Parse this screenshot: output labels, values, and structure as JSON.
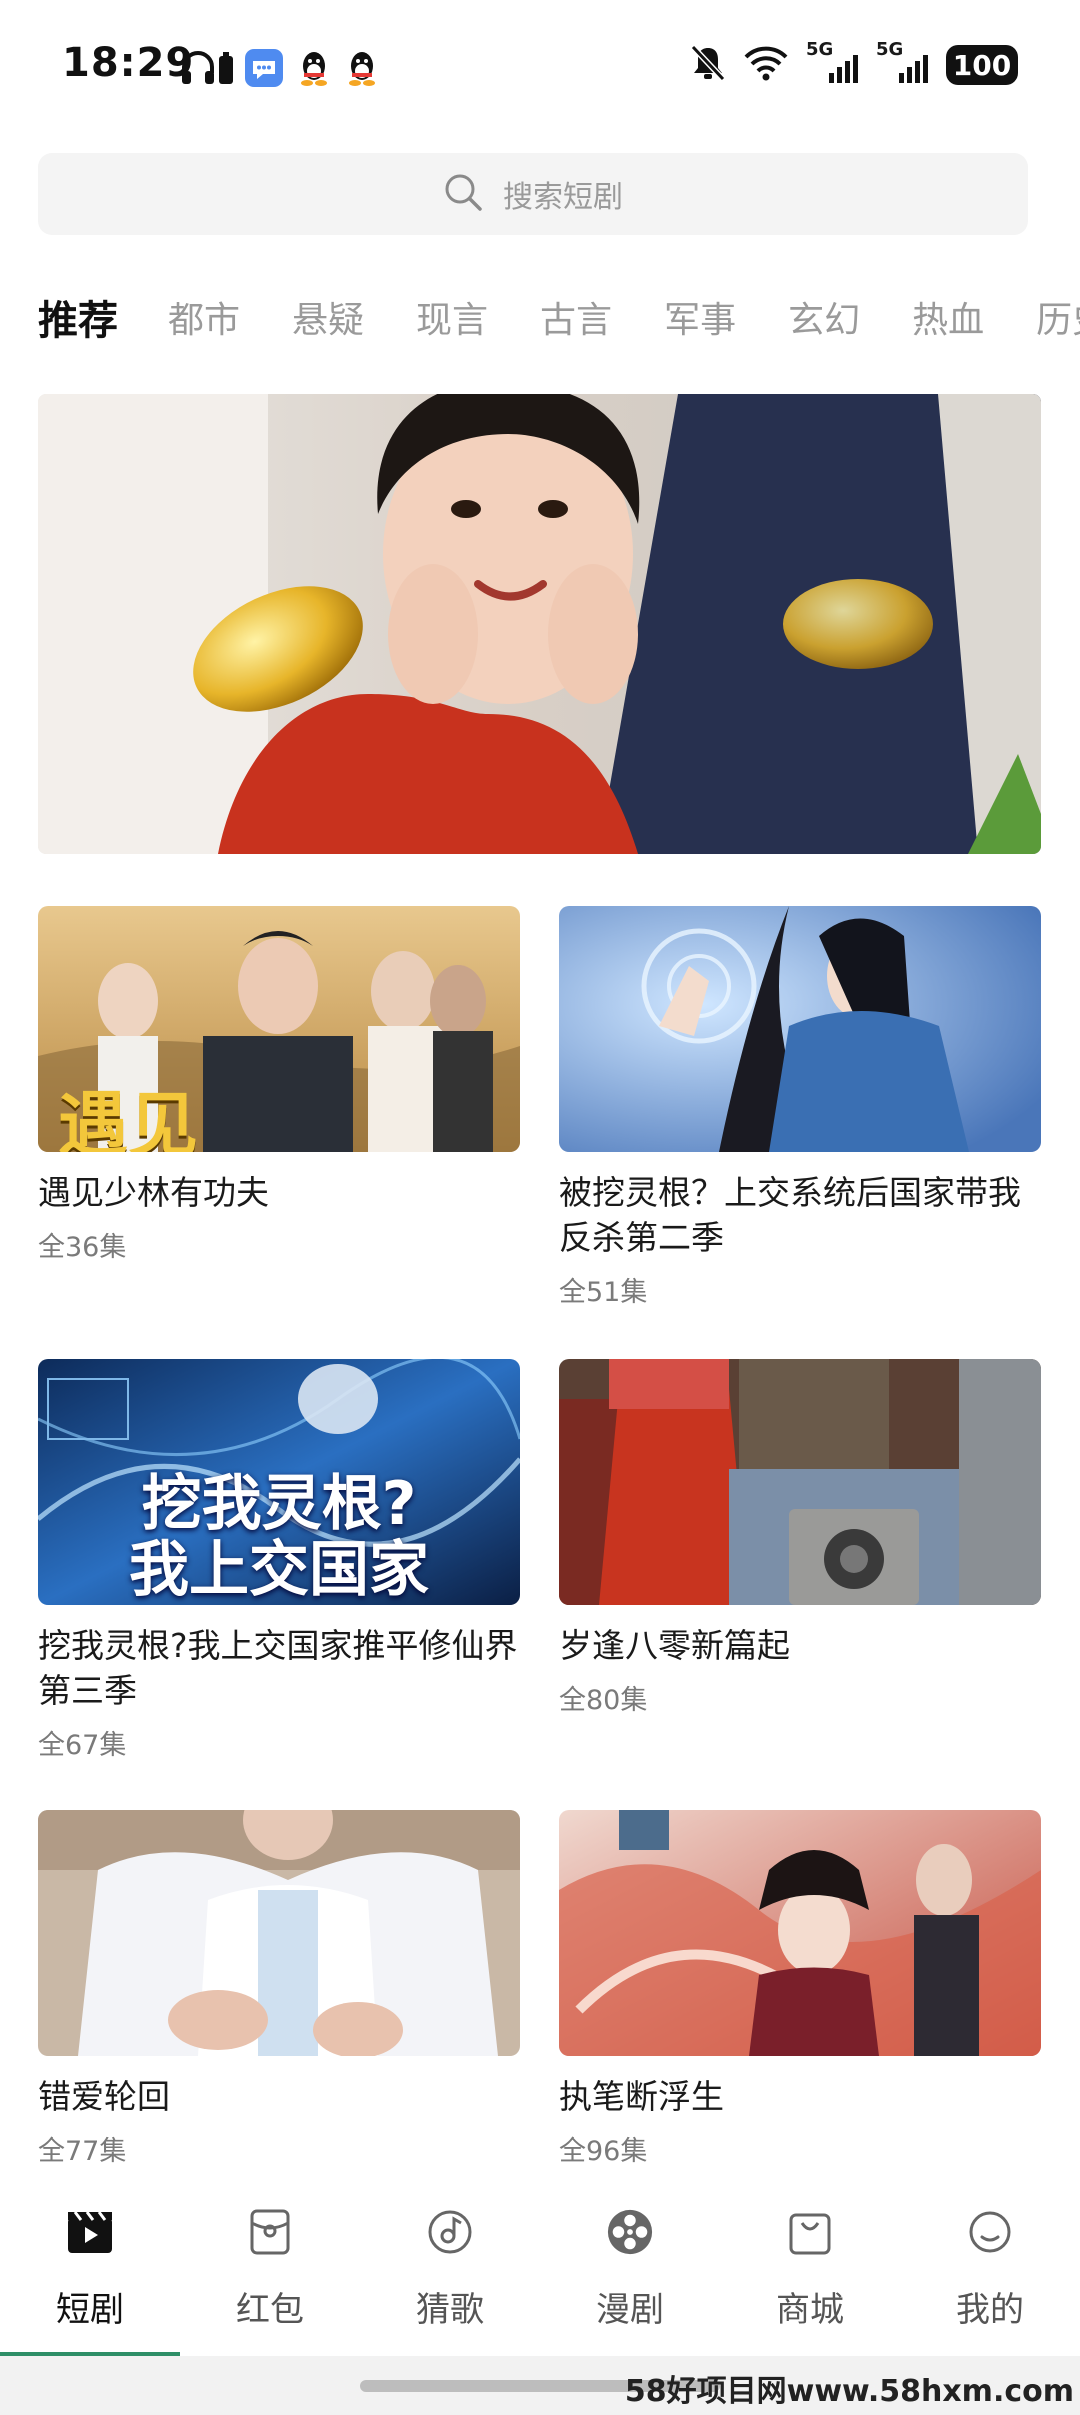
{
  "status_bar": {
    "time": "18:29",
    "network_1": "5G",
    "network_2": "5G",
    "battery": "100",
    "icons": [
      "headphones-icon",
      "battery-small-icon",
      "message-app-icon",
      "qq-icon",
      "qq-icon",
      "mute-bell-icon",
      "wifi-icon",
      "signal-icon",
      "signal-icon"
    ]
  },
  "search": {
    "placeholder": "搜索短剧",
    "icon": "search-icon"
  },
  "categories": [
    {
      "label": "推荐",
      "active": true
    },
    {
      "label": "都市"
    },
    {
      "label": "悬疑"
    },
    {
      "label": "现言"
    },
    {
      "label": "古言"
    },
    {
      "label": "军事"
    },
    {
      "label": "玄幻"
    },
    {
      "label": "热血"
    },
    {
      "label": "历史"
    }
  ],
  "dramas": [
    {
      "title": "遇见少林有功夫",
      "episodes": "全36集",
      "poster_text": "遇见"
    },
    {
      "title": "被挖灵根？上交系统后国家带我反杀第二季",
      "episodes": "全51集",
      "poster_text": ""
    },
    {
      "title": "挖我灵根?我上交国家推平修仙界第三季",
      "episodes": "全67集",
      "poster_text": "挖我灵根?\n我上交国家"
    },
    {
      "title": "岁逢八零新篇起",
      "episodes": "全80集",
      "poster_text": ""
    },
    {
      "title": "错爱轮回",
      "episodes": "全77集",
      "poster_text": ""
    },
    {
      "title": "执笔断浮生",
      "episodes": "全96集",
      "poster_text": ""
    }
  ],
  "bottom_nav": {
    "items": [
      {
        "label": "短剧",
        "icon": "clapperboard-icon",
        "active": true
      },
      {
        "label": "红包",
        "icon": "red-packet-icon"
      },
      {
        "label": "猜歌",
        "icon": "music-disc-icon"
      },
      {
        "label": "漫剧",
        "icon": "film-reel-icon"
      },
      {
        "label": "商城",
        "icon": "shopping-bag-icon"
      },
      {
        "label": "我的",
        "icon": "profile-face-icon"
      }
    ],
    "accent_color": "#2f8f68"
  },
  "watermark": "58好项目网www.58hxm.com"
}
